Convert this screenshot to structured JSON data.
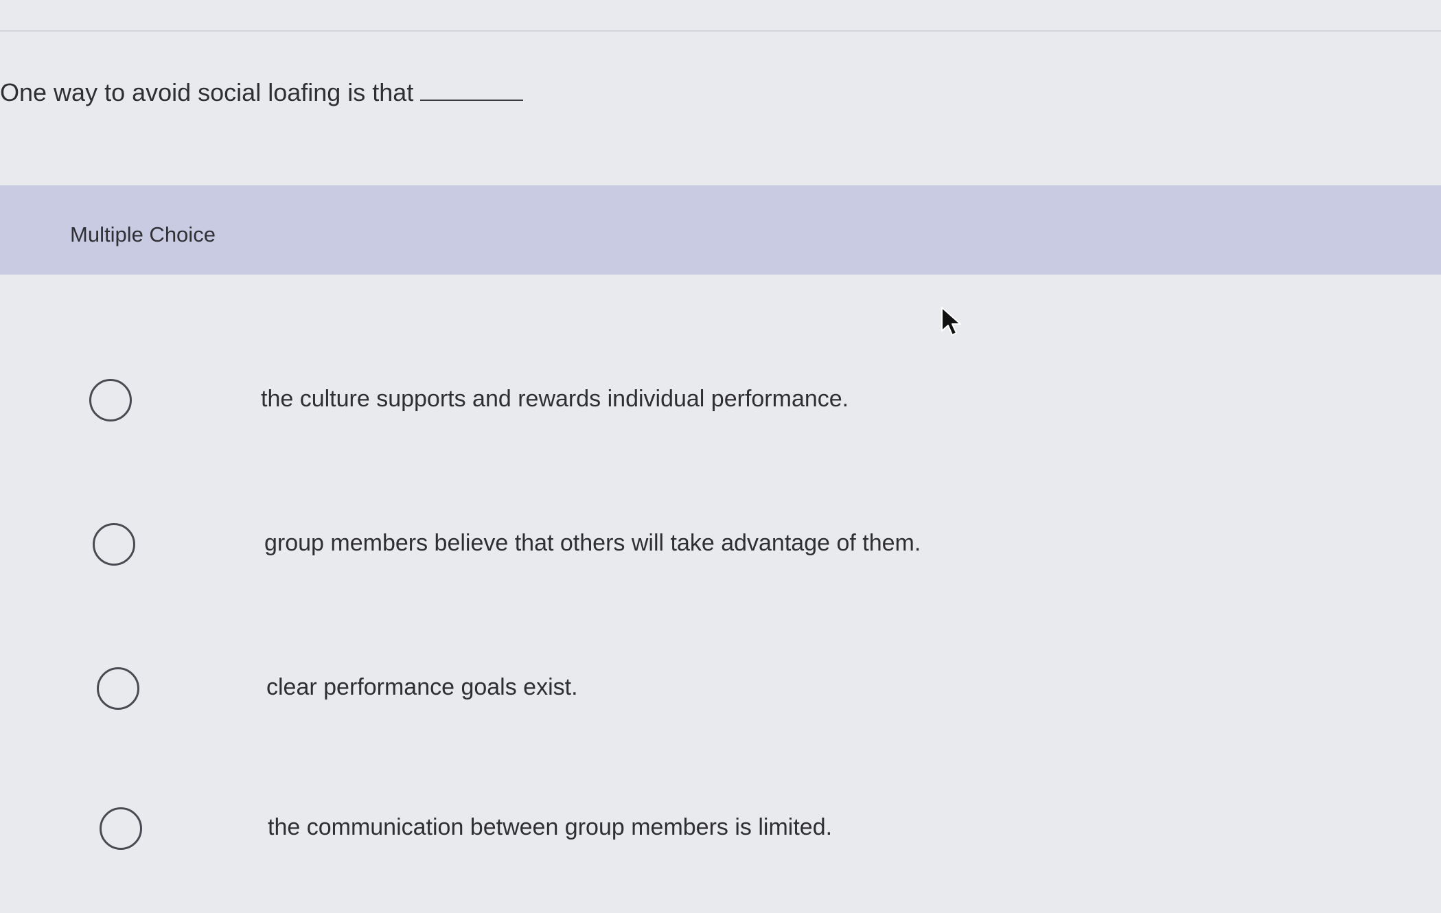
{
  "question": {
    "text": "One way to avoid social loafing is that"
  },
  "section": {
    "label": "Multiple Choice"
  },
  "options": [
    {
      "label": "the culture supports and rewards individual performance.",
      "selected": false
    },
    {
      "label": "group members believe that others will take advantage of them.",
      "selected": false
    },
    {
      "label": "clear performance goals exist.",
      "selected": false
    },
    {
      "label": "the communication between group members is limited.",
      "selected": false
    }
  ],
  "icons": {
    "radio": "radio-unchecked-icon",
    "cursor": "mouse-pointer-icon"
  },
  "colors": {
    "background": "#e9eaee",
    "band": "#c9cbe2",
    "text": "#2e2e33"
  }
}
